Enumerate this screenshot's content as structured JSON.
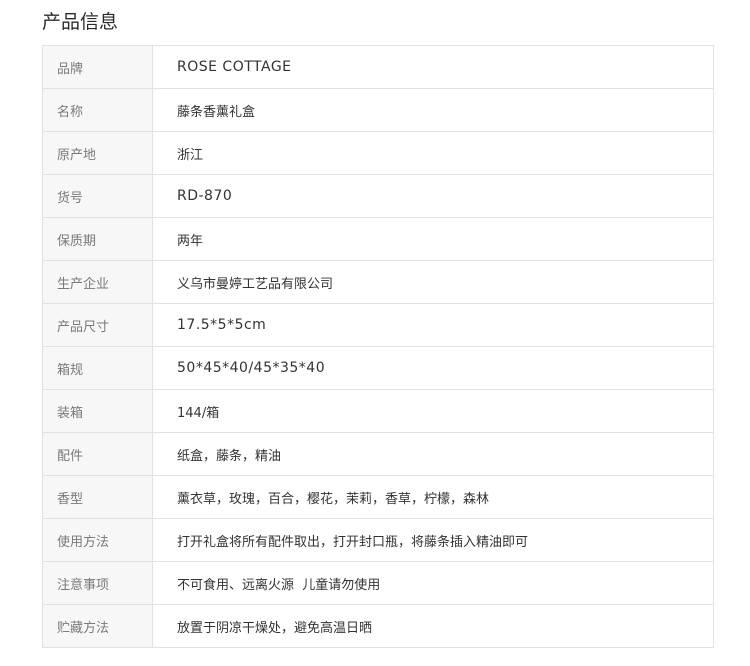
{
  "header": {
    "title": "产品信息"
  },
  "rows": [
    {
      "label": "品牌",
      "value": "ROSE COTTAGE"
    },
    {
      "label": "名称",
      "value": "藤条香薰礼盒"
    },
    {
      "label": "原产地",
      "value": "浙江"
    },
    {
      "label": "货号",
      "value": "RD-870"
    },
    {
      "label": "保质期",
      "value": "两年"
    },
    {
      "label": "生产企业",
      "value": "义乌市曼婷工艺品有限公司"
    },
    {
      "label": "产品尺寸",
      "value": "17.5*5*5cm"
    },
    {
      "label": "箱规",
      "value": "50*45*40/45*35*40"
    },
    {
      "label": "装箱",
      "value": "144/箱"
    },
    {
      "label": "配件",
      "value": "纸盒，藤条，精油"
    },
    {
      "label": "香型",
      "value": "薰衣草，玫瑰，百合，樱花，茉莉，香草，柠檬，森林"
    },
    {
      "label": "使用方法",
      "value": "打开礼盒将所有配件取出，打开封口瓶，将藤条插入精油即可"
    },
    {
      "label": "注意事项",
      "value": "不可食用、远离火源  儿童请勿使用"
    },
    {
      "label": "贮藏方法",
      "value": "放置于阴凉干燥处，避免高温日晒"
    }
  ]
}
